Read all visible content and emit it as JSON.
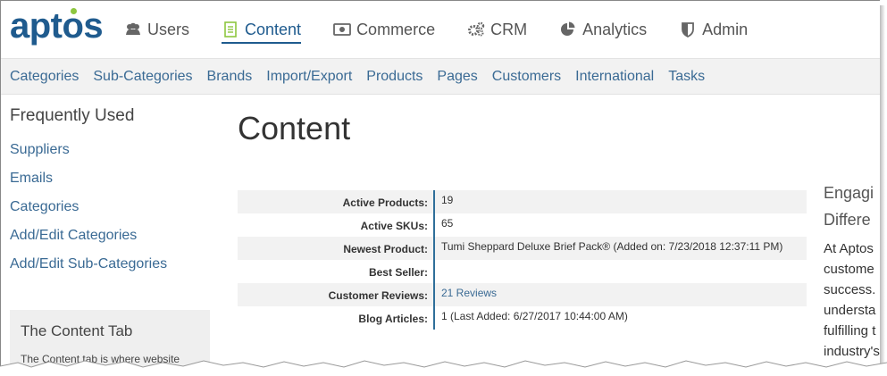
{
  "brand": {
    "logo_text": "aptos",
    "colors": {
      "primary": "#1f5b8e",
      "accent": "#8dc63f",
      "link": "#3a6a94"
    }
  },
  "topnav": [
    {
      "label": "Users",
      "icon": "users-icon"
    },
    {
      "label": "Content",
      "icon": "document-icon",
      "active": true
    },
    {
      "label": "Commerce",
      "icon": "money-icon"
    },
    {
      "label": "CRM",
      "icon": "gears-icon"
    },
    {
      "label": "Analytics",
      "icon": "pie-chart-icon"
    },
    {
      "label": "Admin",
      "icon": "shield-icon"
    }
  ],
  "subnav": [
    "Categories",
    "Sub-Categories",
    "Brands",
    "Import/Export",
    "Products",
    "Pages",
    "Customers",
    "International",
    "Tasks"
  ],
  "sidebar": {
    "heading": "Frequently Used",
    "links": [
      "Suppliers",
      "Emails",
      "Categories",
      "Add/Edit Categories",
      "Add/Edit Sub-Categories"
    ],
    "info_box": {
      "title": "The Content Tab",
      "text": "The Content tab is where website"
    }
  },
  "main": {
    "title": "Content",
    "stats": [
      {
        "label": "Active Products:",
        "value": "19"
      },
      {
        "label": "Active SKUs:",
        "value": "65"
      },
      {
        "label": "Newest Product:",
        "value": "Tumi Sheppard Deluxe Brief Pack® (Added on: 7/23/2018 12:37:11 PM)"
      },
      {
        "label": "Best Seller:",
        "value": ""
      },
      {
        "label": "Customer Reviews:",
        "value": "21 Reviews"
      },
      {
        "label": "Blog Articles:",
        "value": "1 (Last Added: 6/27/2017 10:44:00 AM)"
      }
    ]
  },
  "right_column": {
    "heading_lines": [
      "Engagi",
      "Differe"
    ],
    "text_lines": [
      "At Aptos",
      "custome",
      "success.",
      "understa",
      "fulfilling t",
      "industry's"
    ]
  }
}
